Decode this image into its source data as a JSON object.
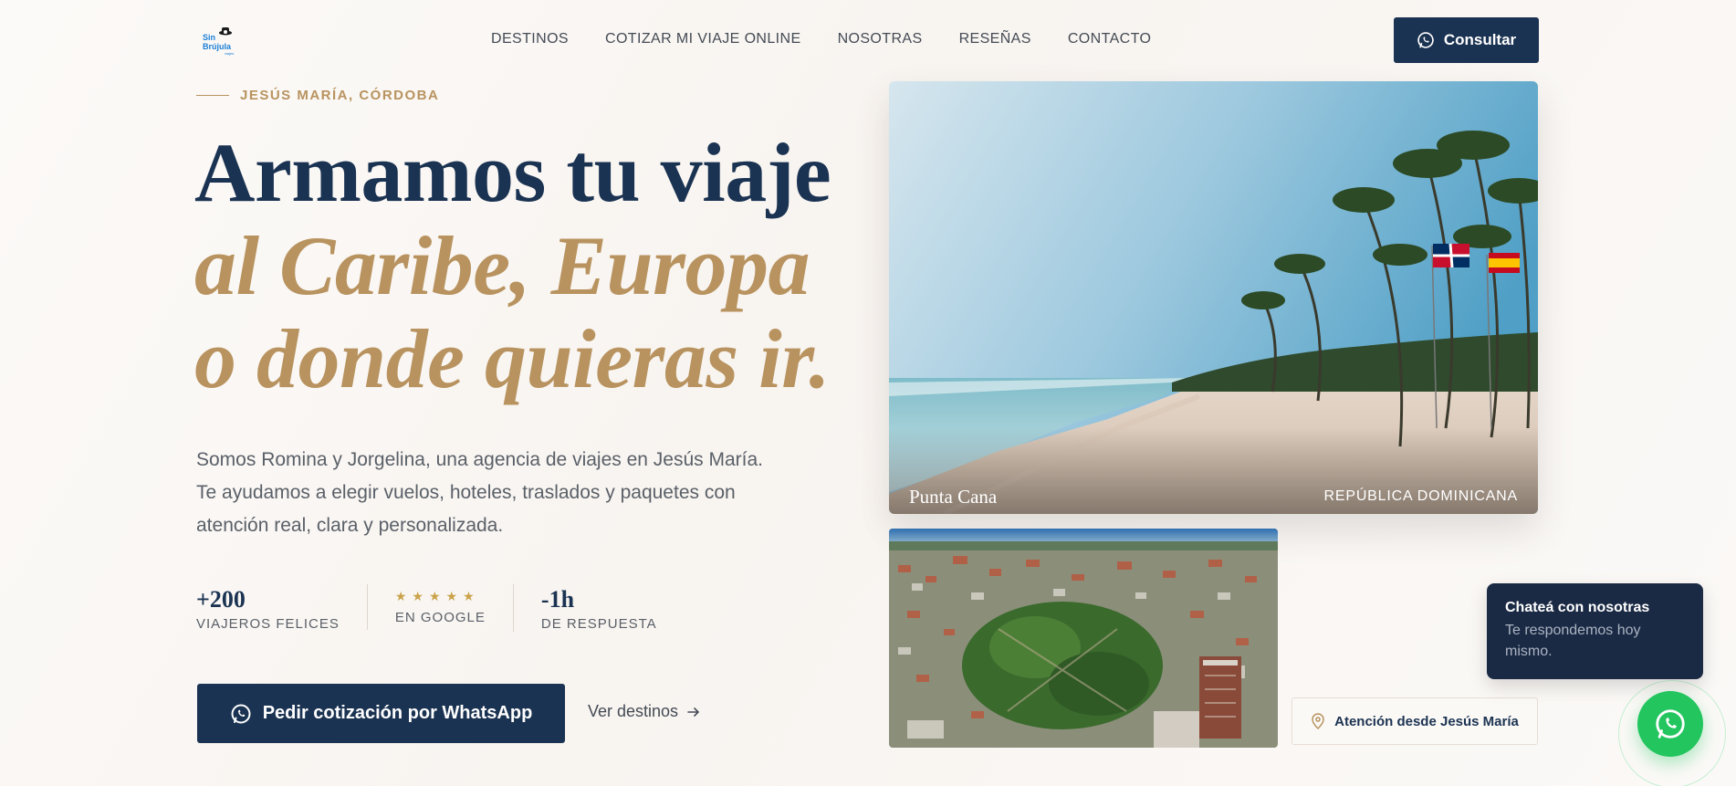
{
  "logo": {
    "line1": "Sin",
    "line2": "Brújula",
    "line3": "viajes"
  },
  "nav": [
    "DESTINOS",
    "COTIZAR MI VIAJE ONLINE",
    "NOSOTRAS",
    "RESEÑAS",
    "CONTACTO"
  ],
  "header": {
    "cta_label": "Consultar"
  },
  "hero": {
    "eyebrow": "JESÚS MARÍA, CÓRDOBA",
    "title_line1": "Armamos tu viaje",
    "title_line2": "al Caribe, Europa",
    "title_line3": "o donde quieras ir.",
    "lead_line1": "Somos Romina y Jorgelina, una agencia de viajes en Jesús María.",
    "lead_line2": "Te ayudamos a elegir vuelos, hoteles, traslados y paquetes con",
    "lead_line3": "atención real, clara y personalizada.",
    "stats": [
      {
        "value": "+200",
        "label": "VIAJEROS FELICES"
      },
      {
        "value": "★★★★★",
        "label": "EN GOOGLE"
      },
      {
        "value": "-1h",
        "label": "DE RESPUESTA"
      }
    ],
    "primary_cta": "Pedir cotización por WhatsApp",
    "secondary_cta": "Ver destinos"
  },
  "photo_main": {
    "place": "Punta Cana",
    "country": "REPÚBLICA DOMINICANA"
  },
  "badge": {
    "label": "Atención desde Jesús María"
  },
  "chat": {
    "title": "Chateá con nosotras",
    "subtitle_line1": "Te respondemos hoy",
    "subtitle_line2": "mismo."
  },
  "colors": {
    "navy": "#1b3352",
    "gold": "#b8935f",
    "whatsapp": "#22c55e",
    "background": "#faf7f4"
  },
  "icons": {
    "whatsapp": "whatsapp-icon",
    "arrow": "arrow-right-icon",
    "pin": "map-pin-icon"
  }
}
